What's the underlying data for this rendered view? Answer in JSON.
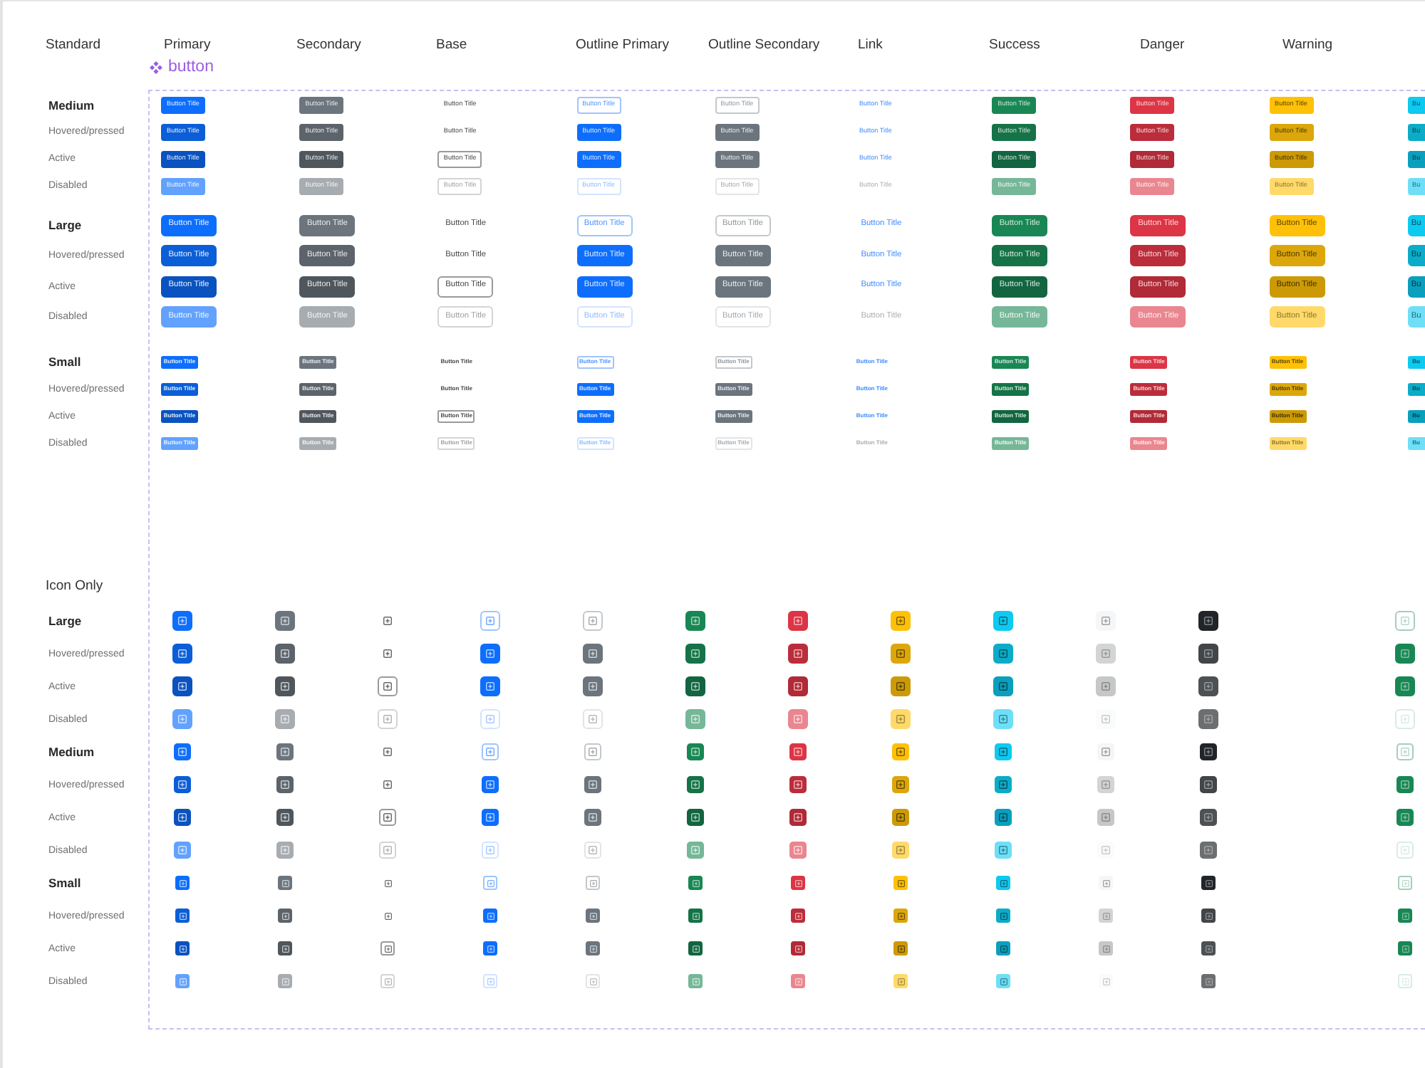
{
  "header": {
    "title": "Standard",
    "columns": [
      "Primary",
      "Secondary",
      "Base",
      "Outline Primary",
      "Outline Secondary",
      "Link",
      "Success",
      "Danger",
      "Warning"
    ]
  },
  "component_tag": {
    "label": "button"
  },
  "standard": {
    "variants": [
      {
        "kind": "primary"
      },
      {
        "kind": "secondary"
      },
      {
        "kind": "base"
      },
      {
        "kind": "outline-primary"
      },
      {
        "kind": "outline-secondary"
      },
      {
        "kind": "link"
      },
      {
        "kind": "success"
      },
      {
        "kind": "danger"
      },
      {
        "kind": "warning"
      },
      {
        "kind": "info"
      }
    ],
    "sections": [
      {
        "kind": "medium",
        "title": "Medium",
        "rows": [
          {
            "kind": "default",
            "buttons": [
              "Button Title",
              "Button Title",
              "Button Title",
              "Button Title",
              "Button Title",
              "Button Title",
              "Button Title",
              "Button Title",
              "Button Title",
              "Bu"
            ]
          },
          {
            "kind": "hover",
            "label": "Hovered/pressed",
            "buttons": [
              "Button Title",
              "Button Title",
              "Button Title",
              "Button Title",
              "Button Title",
              "Button Title",
              "Button Title",
              "Button Title",
              "Button Title",
              "Bu"
            ]
          },
          {
            "kind": "active",
            "label": "Active",
            "buttons": [
              "Button Title",
              "Button Title",
              "Button Title",
              "Button Title",
              "Button Title",
              "Button Title",
              "Button Title",
              "Button Title",
              "Button Title",
              "Bu"
            ]
          },
          {
            "kind": "disabled",
            "label": "Disabled",
            "buttons": [
              "Button Title",
              "Button Title",
              "Button Title",
              "Button Title",
              "Button Title",
              "Button Title",
              "Button Title",
              "Button Title",
              "Button Title",
              "Bu"
            ]
          }
        ]
      },
      {
        "kind": "large",
        "title": "Large",
        "rows": [
          {
            "kind": "default",
            "buttons": [
              "Button Title",
              "Button Title",
              "Button Title",
              "Button Title",
              "Button Title",
              "Button Title",
              "Button Title",
              "Button Title",
              "Button Title",
              "Bu"
            ]
          },
          {
            "kind": "hover",
            "label": "Hovered/pressed",
            "buttons": [
              "Button Title",
              "Button Title",
              "Button Title",
              "Button Title",
              "Button Title",
              "Button Title",
              "Button Title",
              "Button Title",
              "Button Title",
              "Bu"
            ]
          },
          {
            "kind": "active",
            "label": "Active",
            "buttons": [
              "Button Title",
              "Button Title",
              "Button Title",
              "Button Title",
              "Button Title",
              "Button Title",
              "Button Title",
              "Button Title",
              "Button Title",
              "Bu"
            ]
          },
          {
            "kind": "disabled",
            "label": "Disabled",
            "buttons": [
              "Button Title",
              "Button Title",
              "Button Title",
              "Button Title",
              "Button Title",
              "Button Title",
              "Button Title",
              "Button Title",
              "Button Title",
              "Bu"
            ]
          }
        ]
      },
      {
        "kind": "small",
        "title": "Small",
        "rows": [
          {
            "kind": "default",
            "buttons": [
              "Button Title",
              "Button Title",
              "Button Title",
              "Button Title",
              "Button Title",
              "Button Title",
              "Button Title",
              "Button Title",
              "Button Title",
              "Bu"
            ]
          },
          {
            "kind": "hover",
            "label": "Hovered/pressed",
            "buttons": [
              "Button Title",
              "Button Title",
              "Button Title",
              "Button Title",
              "Button Title",
              "Button Title",
              "Button Title",
              "Button Title",
              "Button Title",
              "Bu"
            ]
          },
          {
            "kind": "active",
            "label": "Active",
            "buttons": [
              "Button Title",
              "Button Title",
              "Button Title",
              "Button Title",
              "Button Title",
              "Button Title",
              "Button Title",
              "Button Title",
              "Button Title",
              "Bu"
            ]
          },
          {
            "kind": "disabled",
            "label": "Disabled",
            "buttons": [
              "Button Title",
              "Button Title",
              "Button Title",
              "Button Title",
              "Button Title",
              "Button Title",
              "Button Title",
              "Button Title",
              "Button Title",
              "Bu"
            ]
          }
        ]
      }
    ]
  },
  "icon_only": {
    "title": "Icon Only",
    "variants": [
      {
        "kind": "primary"
      },
      {
        "kind": "secondary"
      },
      {
        "kind": "base"
      },
      {
        "kind": "outline-primary"
      },
      {
        "kind": "outline-secondary"
      },
      {
        "kind": "success"
      },
      {
        "kind": "danger"
      },
      {
        "kind": "warning"
      },
      {
        "kind": "info"
      },
      {
        "kind": "light"
      },
      {
        "kind": "dark"
      },
      {
        "kind": "outline-success"
      }
    ],
    "sections": [
      {
        "kind": "large",
        "title": "Large",
        "rows": [
          {
            "kind": "default"
          },
          {
            "kind": "hover",
            "label": "Hovered/pressed"
          },
          {
            "kind": "active",
            "label": "Active"
          },
          {
            "kind": "disabled",
            "label": "Disabled"
          }
        ]
      },
      {
        "kind": "medium",
        "title": "Medium",
        "rows": [
          {
            "kind": "default"
          },
          {
            "kind": "hover",
            "label": "Hovered/pressed"
          },
          {
            "kind": "active",
            "label": "Active"
          },
          {
            "kind": "disabled",
            "label": "Disabled"
          }
        ]
      },
      {
        "kind": "small",
        "title": "Small",
        "rows": [
          {
            "kind": "default"
          },
          {
            "kind": "hover",
            "label": "Hovered/pressed"
          },
          {
            "kind": "active",
            "label": "Active"
          },
          {
            "kind": "disabled",
            "label": "Disabled"
          }
        ]
      }
    ]
  }
}
